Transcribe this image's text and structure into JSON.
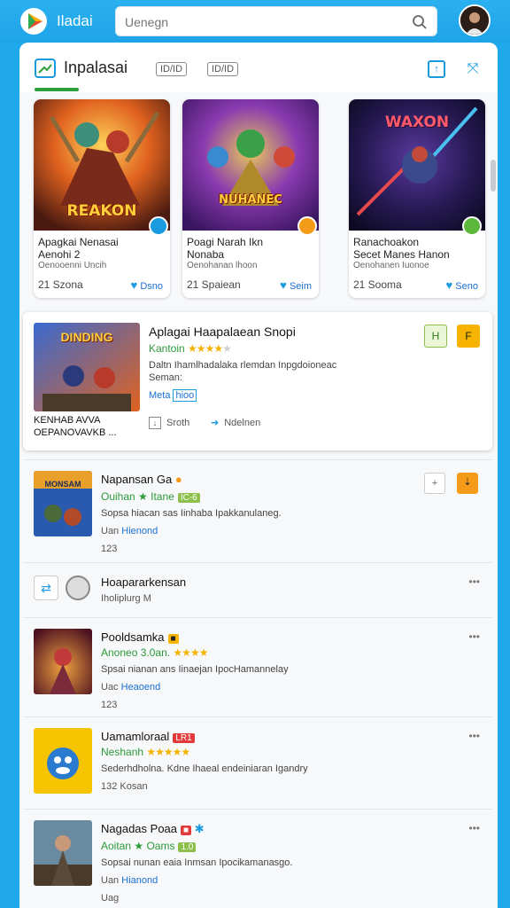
{
  "header": {
    "app_name": "Iladai",
    "search_placeholder": "Uenegn",
    "search_icon": "search-icon",
    "avatar_icon": "user-avatar"
  },
  "tabs": {
    "main_label": "Inpalasai",
    "tab_b": "ID/ID",
    "tab_c": "ID/ID"
  },
  "featured": [
    {
      "art_title": "REAKON",
      "title": "Apagkai Nenasai",
      "subtitle": "Aenohi 2",
      "meta": "Oenooenni Uncih",
      "count": "21 Szona",
      "action": "Dsno",
      "badge_color": "#1a9be0"
    },
    {
      "art_title": "NUHANEC",
      "title": "Poagi Narah Ikn",
      "subtitle": "Nonaba",
      "meta": "Oenohanan lhoon",
      "count": "21 Spaiean",
      "action": "Seim",
      "badge_color": "#f59b1a"
    },
    {
      "art_title": "WAXON",
      "title": "Ranachoakon",
      "subtitle": "Secet Manes Hanon",
      "meta": "Oenohanen Iuonoe",
      "count": "21 Sooma",
      "action": "Seno",
      "badge_color": "#5cb83a"
    }
  ],
  "highlight": {
    "thumb_text": "DINDING",
    "caption1": "KENHAB AVVA",
    "caption2": "OEPANOVAVKB ...",
    "title": "Aplagai Haapalaean Snopi",
    "developer": "Kantoin",
    "rating": "4",
    "desc1": "Daltn Ihamlhadalaka rlemdan Inpgdoioneac",
    "desc2": "Seman:",
    "more": "Meta",
    "more_tag": "hioo",
    "action1": "Sroth",
    "action2": "Ndelnen",
    "btn1": "H",
    "btn2": "F"
  },
  "list": [
    {
      "thumb_text": "MONSAM",
      "title": "Napansan Ga",
      "developer": "Ouihan ★ Itane",
      "tag": "IC-6",
      "desc": "Sopsa hiacan sas Iinhaba Ipakkanulaneg.",
      "more_prefix": "Uan",
      "more_link": "Hienond",
      "count": "123"
    },
    {
      "thumb_text": "",
      "title": "Hoapararkensan",
      "developer": "",
      "tag": "",
      "desc": "",
      "more_prefix": "Iholiplurg M",
      "more_link": "",
      "count": ""
    },
    {
      "thumb_text": "",
      "title": "Pooldsamka",
      "developer": "Anoneo 3.0an.",
      "tag": "",
      "desc": "Spsai nianan ans Iinaejan IpocHamannelay",
      "more_prefix": "Uac",
      "more_link": "Heaoend",
      "count": "123"
    },
    {
      "thumb_text": "",
      "title": "Uamamloraal",
      "developer": "Neshanh",
      "tag": "LR1",
      "desc": "Sederhdholna. Kdne Ihaeal endeiniaran Igandry",
      "more_prefix": "",
      "more_link": "",
      "count": "132 Kosan"
    },
    {
      "thumb_text": "",
      "title": "Nagadas Poaa",
      "developer": "Aoitan ★ Oams",
      "tag": "1.0",
      "desc": "Sopsai nunan eaia Inmsan Ipocikamanasgo.",
      "more_prefix": "Uan",
      "more_link": "Hianond",
      "count": "Uag"
    }
  ],
  "colors": {
    "topbar": "#1ea4e8",
    "accent_blue": "#1a9be0",
    "accent_green": "#2d9a3a",
    "star": "#f5b301"
  }
}
